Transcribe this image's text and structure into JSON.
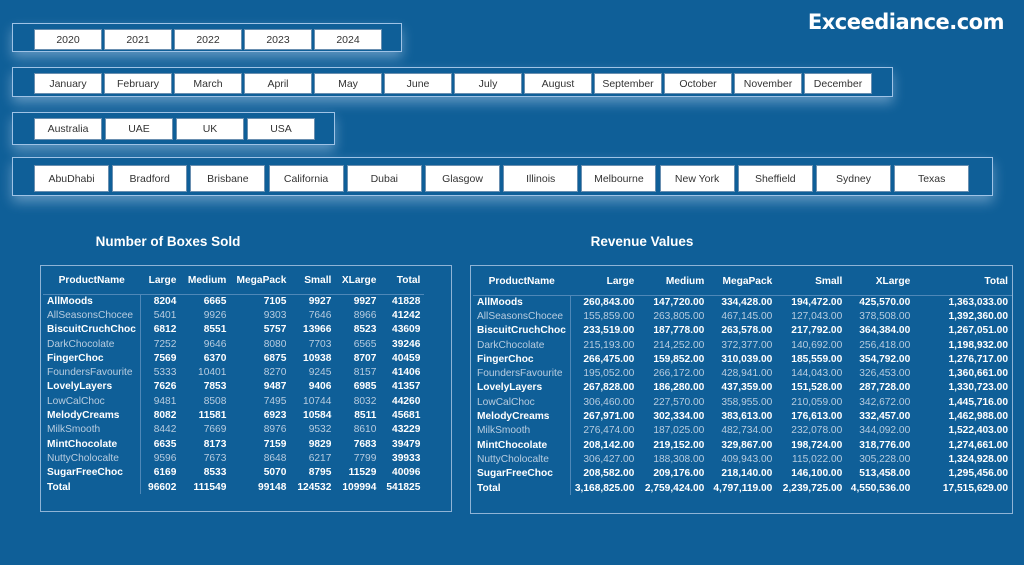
{
  "brand": "Exceediance.com",
  "colors": {
    "background": "#0f5f98",
    "button": "#ffffff",
    "slicer_border": "#9fc3e6"
  },
  "slicers": {
    "years": [
      "2020",
      "2021",
      "2022",
      "2023",
      "2024"
    ],
    "months": [
      "January",
      "February",
      "March",
      "April",
      "May",
      "June",
      "July",
      "August",
      "September",
      "October",
      "November",
      "December"
    ],
    "countries": [
      "Australia",
      "UAE",
      "UK",
      "USA"
    ],
    "cities": [
      "AbuDhabi",
      "Bradford",
      "Brisbane",
      "California",
      "Dubai",
      "Glasgow",
      "Illinois",
      "Melbourne",
      "New York",
      "Sheffield",
      "Sydney",
      "Texas"
    ]
  },
  "boxes_table": {
    "title": "Number of Boxes Sold",
    "columns": [
      "ProductName",
      "Large",
      "Medium",
      "MegaPack",
      "Small",
      "XLarge",
      "Total"
    ],
    "rows": [
      [
        "AllMoods",
        "8204",
        "6665",
        "7105",
        "9927",
        "9927",
        "41828"
      ],
      [
        "AllSeasonsChocee",
        "5401",
        "9926",
        "9303",
        "7646",
        "8966",
        "41242"
      ],
      [
        "BiscuitCruchChoc",
        "6812",
        "8551",
        "5757",
        "13966",
        "8523",
        "43609"
      ],
      [
        "DarkChocolate",
        "7252",
        "9646",
        "8080",
        "7703",
        "6565",
        "39246"
      ],
      [
        "FingerChoc",
        "7569",
        "6370",
        "6875",
        "10938",
        "8707",
        "40459"
      ],
      [
        "FoundersFavourite",
        "5333",
        "10401",
        "8270",
        "9245",
        "8157",
        "41406"
      ],
      [
        "LovelyLayers",
        "7626",
        "7853",
        "9487",
        "9406",
        "6985",
        "41357"
      ],
      [
        "LowCalChoc",
        "9481",
        "8508",
        "7495",
        "10744",
        "8032",
        "44260"
      ],
      [
        "MelodyCreams",
        "8082",
        "11581",
        "6923",
        "10584",
        "8511",
        "45681"
      ],
      [
        "MilkSmooth",
        "8442",
        "7669",
        "8976",
        "9532",
        "8610",
        "43229"
      ],
      [
        "MintChocolate",
        "6635",
        "8173",
        "7159",
        "9829",
        "7683",
        "39479"
      ],
      [
        "NuttyCholocalte",
        "9596",
        "7673",
        "8648",
        "6217",
        "7799",
        "39933"
      ],
      [
        "SugarFreeChoc",
        "6169",
        "8533",
        "5070",
        "8795",
        "11529",
        "40096"
      ]
    ],
    "total": [
      "Total",
      "96602",
      "111549",
      "99148",
      "124532",
      "109994",
      "541825"
    ]
  },
  "revenue_table": {
    "title": "Revenue Values",
    "columns": [
      "ProductName",
      "Large",
      "Medium",
      "MegaPack",
      "Small",
      "XLarge",
      "Total"
    ],
    "rows": [
      [
        "AllMoods",
        "260,843.00",
        "147,720.00",
        "334,428.00",
        "194,472.00",
        "425,570.00",
        "1,363,033.00"
      ],
      [
        "AllSeasonsChocee",
        "155,859.00",
        "263,805.00",
        "467,145.00",
        "127,043.00",
        "378,508.00",
        "1,392,360.00"
      ],
      [
        "BiscuitCruchChoc",
        "233,519.00",
        "187,778.00",
        "263,578.00",
        "217,792.00",
        "364,384.00",
        "1,267,051.00"
      ],
      [
        "DarkChocolate",
        "215,193.00",
        "214,252.00",
        "372,377.00",
        "140,692.00",
        "256,418.00",
        "1,198,932.00"
      ],
      [
        "FingerChoc",
        "266,475.00",
        "159,852.00",
        "310,039.00",
        "185,559.00",
        "354,792.00",
        "1,276,717.00"
      ],
      [
        "FoundersFavourite",
        "195,052.00",
        "266,172.00",
        "428,941.00",
        "144,043.00",
        "326,453.00",
        "1,360,661.00"
      ],
      [
        "LovelyLayers",
        "267,828.00",
        "186,280.00",
        "437,359.00",
        "151,528.00",
        "287,728.00",
        "1,330,723.00"
      ],
      [
        "LowCalChoc",
        "306,460.00",
        "227,570.00",
        "358,955.00",
        "210,059.00",
        "342,672.00",
        "1,445,716.00"
      ],
      [
        "MelodyCreams",
        "267,971.00",
        "302,334.00",
        "383,613.00",
        "176,613.00",
        "332,457.00",
        "1,462,988.00"
      ],
      [
        "MilkSmooth",
        "276,474.00",
        "187,025.00",
        "482,734.00",
        "232,078.00",
        "344,092.00",
        "1,522,403.00"
      ],
      [
        "MintChocolate",
        "208,142.00",
        "219,152.00",
        "329,867.00",
        "198,724.00",
        "318,776.00",
        "1,274,661.00"
      ],
      [
        "NuttyCholocalte",
        "306,427.00",
        "188,308.00",
        "409,943.00",
        "115,022.00",
        "305,228.00",
        "1,324,928.00"
      ],
      [
        "SugarFreeChoc",
        "208,582.00",
        "209,176.00",
        "218,140.00",
        "146,100.00",
        "513,458.00",
        "1,295,456.00"
      ]
    ],
    "total": [
      "Total",
      "3,168,825.00",
      "2,759,424.00",
      "4,797,119.00",
      "2,239,725.00",
      "4,550,536.00",
      "17,515,629.00"
    ]
  }
}
